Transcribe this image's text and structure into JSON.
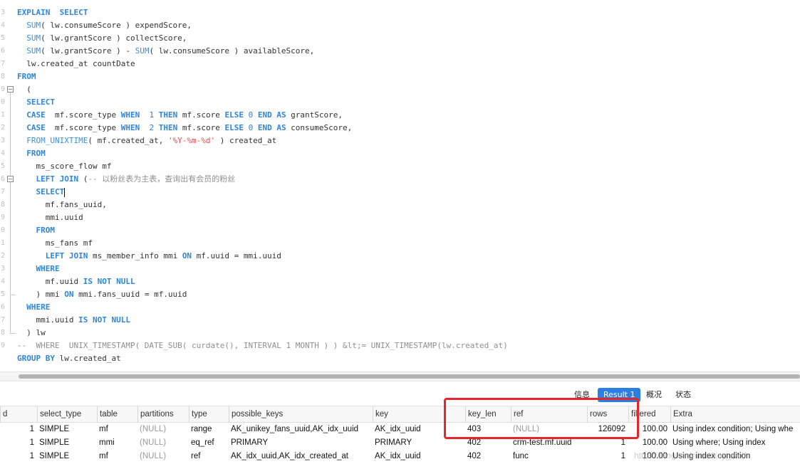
{
  "editor": {
    "line_numbers": [
      "3",
      "4",
      "5",
      "6",
      "7",
      "8",
      "9",
      "0",
      "1",
      "2",
      "3",
      "4",
      "5",
      "6",
      "7",
      "8",
      "9",
      "0",
      "1",
      "2",
      "3",
      "4",
      "5",
      "6",
      "7",
      "8",
      "9"
    ],
    "lines": [
      [
        [
          "kw",
          "EXPLAIN  SELECT"
        ]
      ],
      [
        [
          "",
          "  "
        ],
        [
          "fn",
          "SUM"
        ],
        [
          "",
          "( lw.consumeScore ) expendScore,"
        ]
      ],
      [
        [
          "",
          "  "
        ],
        [
          "fn",
          "SUM"
        ],
        [
          "",
          "( lw.grantScore ) collectScore,"
        ]
      ],
      [
        [
          "",
          "  "
        ],
        [
          "fn",
          "SUM"
        ],
        [
          "",
          "( lw.grantScore ) - "
        ],
        [
          "fn",
          "SUM"
        ],
        [
          "",
          "( lw.consumeScore ) availableScore,"
        ]
      ],
      [
        [
          "",
          "  lw.created_at countDate"
        ]
      ],
      [
        [
          "kw",
          "FROM"
        ]
      ],
      [
        [
          "",
          "  ("
        ]
      ],
      [
        [
          "",
          "  "
        ],
        [
          "kw",
          "SELECT"
        ]
      ],
      [
        [
          "",
          "  "
        ],
        [
          "kw",
          "CASE"
        ],
        [
          "",
          "  mf.score_type "
        ],
        [
          "kw",
          "WHEN"
        ],
        [
          "",
          "  "
        ],
        [
          "num",
          "1"
        ],
        [
          "",
          ""
        ],
        [
          "kw",
          " THEN"
        ],
        [
          "",
          " mf.score "
        ],
        [
          "kw",
          "ELSE"
        ],
        [
          "",
          ""
        ],
        [
          "num",
          " 0"
        ],
        [
          "",
          ""
        ],
        [
          "kw",
          " END AS"
        ],
        [
          "",
          " grantScore,"
        ]
      ],
      [
        [
          "",
          "  "
        ],
        [
          "kw",
          "CASE"
        ],
        [
          "",
          "  mf.score_type "
        ],
        [
          "kw",
          "WHEN"
        ],
        [
          "",
          "  "
        ],
        [
          "num",
          "2"
        ],
        [
          "",
          ""
        ],
        [
          "kw",
          " THEN"
        ],
        [
          "",
          " mf.score "
        ],
        [
          "kw",
          "ELSE"
        ],
        [
          "",
          ""
        ],
        [
          "num",
          " 0"
        ],
        [
          "",
          ""
        ],
        [
          "kw",
          " END AS"
        ],
        [
          "",
          " consumeScore,"
        ]
      ],
      [
        [
          "",
          "  "
        ],
        [
          "fn",
          "FROM_UNIXTIME"
        ],
        [
          "",
          "( mf.created_at, "
        ],
        [
          "str",
          "'%Y-%m-%d'"
        ],
        [
          "",
          " ) created_at"
        ]
      ],
      [
        [
          "",
          "  "
        ],
        [
          "kw",
          "FROM"
        ]
      ],
      [
        [
          "",
          "    ms_score_flow mf"
        ]
      ],
      [
        [
          "",
          "    "
        ],
        [
          "kw",
          "LEFT JOIN"
        ],
        [
          "",
          " ("
        ],
        [
          "cm",
          "-- 以粉丝表为主表，查询出有会员的粉丝"
        ]
      ],
      [
        [
          "",
          "    "
        ],
        [
          "kw",
          "SELECT"
        ],
        [
          "caret",
          ""
        ]
      ],
      [
        [
          "",
          "      mf.fans_uuid,"
        ]
      ],
      [
        [
          "",
          "      mmi.uuid"
        ]
      ],
      [
        [
          "",
          "    "
        ],
        [
          "kw",
          "FROM"
        ]
      ],
      [
        [
          "",
          "      ms_fans mf"
        ]
      ],
      [
        [
          "",
          "      "
        ],
        [
          "kw",
          "LEFT JOIN"
        ],
        [
          "",
          " ms_member_info mmi "
        ],
        [
          "kw",
          "ON"
        ],
        [
          "",
          " mf.uuid = mmi.uuid"
        ]
      ],
      [
        [
          "",
          "    "
        ],
        [
          "kw",
          "WHERE"
        ]
      ],
      [
        [
          "",
          "      mf.uuid "
        ],
        [
          "kw",
          "IS NOT NULL"
        ]
      ],
      [
        [
          "",
          "    ) mmi "
        ],
        [
          "kw",
          "ON"
        ],
        [
          "",
          " mmi.fans_uuid = mf.uuid"
        ]
      ],
      [
        [
          "",
          "  "
        ],
        [
          "kw",
          "WHERE"
        ]
      ],
      [
        [
          "",
          "    mmi.uuid "
        ],
        [
          "kw",
          "IS NOT NULL"
        ]
      ],
      [
        [
          "",
          "  ) lw"
        ]
      ],
      [
        [
          "cm",
          "--  WHERE  UNIX_TIMESTAMP( DATE_SUB( curdate(), INTERVAL 1 MONTH ) ) &lt;= UNIX_TIMESTAMP(lw.created_at)"
        ]
      ],
      [
        [
          "kw",
          "GROUP BY"
        ],
        [
          "",
          " lw.created_at"
        ]
      ]
    ]
  },
  "tabs": {
    "info": "信息",
    "result1": "Result 1",
    "overview": "概况",
    "status": "状态"
  },
  "grid": {
    "columns": [
      "d",
      "select_type",
      "table",
      "partitions",
      "type",
      "possible_keys",
      "key",
      "key_len",
      "ref",
      "rows",
      "filtered",
      "Extra"
    ],
    "rows": [
      [
        "1",
        "SIMPLE",
        "mf",
        "(NULL)",
        "range",
        "AK_unikey_fans_uuid,AK_idx_uuid",
        "AK_idx_uuid",
        "403",
        "(NULL)",
        "126092",
        "100.00",
        "Using index condition; Using whe"
      ],
      [
        "1",
        "SIMPLE",
        "mmi",
        "(NULL)",
        "eq_ref",
        "PRIMARY",
        "PRIMARY",
        "402",
        "crm-test.mf.uuid",
        "1",
        "100.00",
        "Using where; Using index"
      ],
      [
        "1",
        "SIMPLE",
        "mf",
        "(NULL)",
        "ref",
        "AK_idx_uuid,AK_idx_created_at",
        "AK_idx_uuid",
        "402",
        "func",
        "1",
        "100.00",
        "Using index condition"
      ]
    ]
  },
  "watermark": "https://blog.csdn.net/key_wolf",
  "colors": {
    "keyword": "#2f86d8",
    "string": "#d9534f",
    "comment": "#8f8f8f",
    "active_tab": "#2a7fe5",
    "highlight_box": "#e5262b"
  }
}
